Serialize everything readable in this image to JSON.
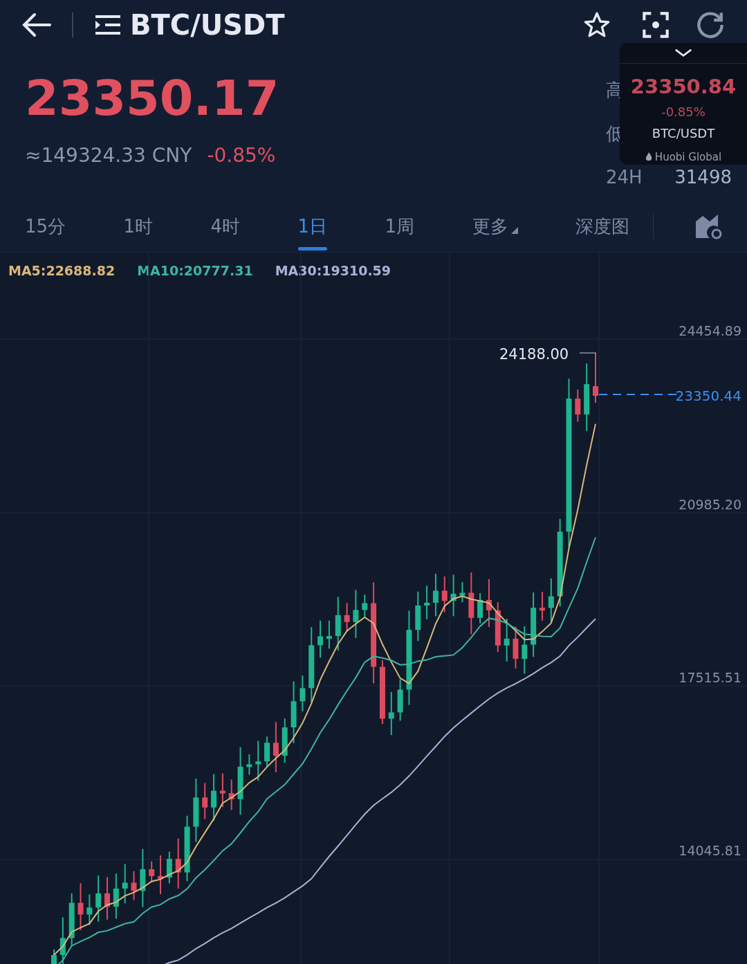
{
  "header": {
    "pair": "BTC/USDT"
  },
  "price": {
    "last": "23350.17",
    "cny": "≈149324.33 CNY",
    "change": "-0.85%"
  },
  "stats": [
    {
      "label": "高"
    },
    {
      "label": "低"
    },
    {
      "label": "24H",
      "value": "31498"
    }
  ],
  "floating_widget": {
    "price": "23350.84",
    "change": "-0.85%",
    "pair": "BTC/USDT",
    "brand": "Huobi Global"
  },
  "tabs": [
    {
      "label": "15分",
      "selected": false,
      "kind": "plain"
    },
    {
      "label": "1时",
      "selected": false,
      "kind": "plain"
    },
    {
      "label": "4时",
      "selected": false,
      "kind": "plain"
    },
    {
      "label": "1日",
      "selected": true,
      "kind": "plain"
    },
    {
      "label": "1周",
      "selected": false,
      "kind": "plain"
    },
    {
      "label": "更多",
      "selected": false,
      "kind": "dropdown"
    },
    {
      "label": "深度图",
      "selected": false,
      "kind": "plain"
    }
  ],
  "indicators": [
    {
      "label": "MA5:22688.82",
      "color": "#d9b77a"
    },
    {
      "label": "MA10:20777.31",
      "color": "#3fb59e"
    },
    {
      "label": "MA30:19310.59",
      "color": "#a9b1d6"
    }
  ],
  "chart": {
    "y_axis": [
      "24454.89",
      "20985.20",
      "17515.51",
      "14045.81"
    ],
    "high_label": "24188.00",
    "current_price": "23350.44"
  }
}
